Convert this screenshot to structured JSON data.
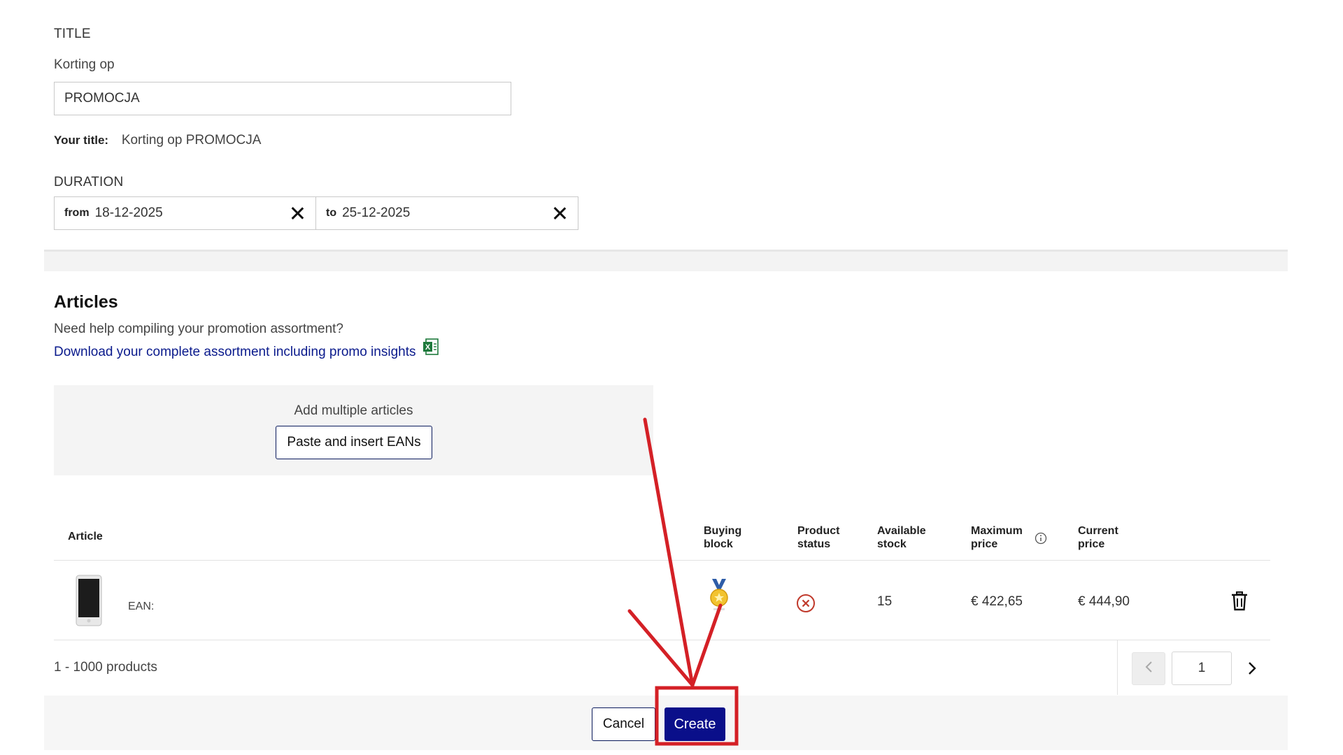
{
  "title_section": {
    "heading": "TITLE",
    "prefix_label": "Korting op",
    "input_value": "PROMOCJA",
    "your_title_label": "Your title:",
    "your_title_value": "Korting op PROMOCJA"
  },
  "duration": {
    "heading": "DURATION",
    "from_label": "from",
    "from_value": "18-12-2025",
    "to_label": "to",
    "to_value": "25-12-2025"
  },
  "articles": {
    "heading": "Articles",
    "help_text": "Need help compiling your promotion assortment?",
    "download_link": "Download your complete assortment including promo insights",
    "add_multiple_label": "Add multiple articles",
    "paste_button": "Paste and insert EANs"
  },
  "table": {
    "headers": {
      "article": "Article",
      "buying_block_1": "Buying",
      "buying_block_2": "block",
      "product_status_1": "Product",
      "product_status_2": "status",
      "available_stock_1": "Available",
      "available_stock_2": "stock",
      "maximum_price_1": "Maximum",
      "maximum_price_2": "price",
      "current_price_1": "Current",
      "current_price_2": "price"
    },
    "rows": [
      {
        "ean_label": "EAN:",
        "available_stock": "15",
        "maximum_price": "€ 422,65",
        "current_price": "€ 444,90"
      }
    ]
  },
  "pagination": {
    "range_text": "1 - 1000 products",
    "page_value": "1"
  },
  "actions": {
    "cancel": "Cancel",
    "create": "Create"
  },
  "colors": {
    "primary": "#0a0f8a",
    "link": "#0a1a8c",
    "annotation": "#d42026",
    "status_error": "#c0392b"
  },
  "icons": {
    "clear": "close-icon",
    "excel": "excel-file-icon",
    "info": "info-icon",
    "delete": "trash-icon",
    "status": "error-circle-icon",
    "buying_block": "medal-icon"
  }
}
